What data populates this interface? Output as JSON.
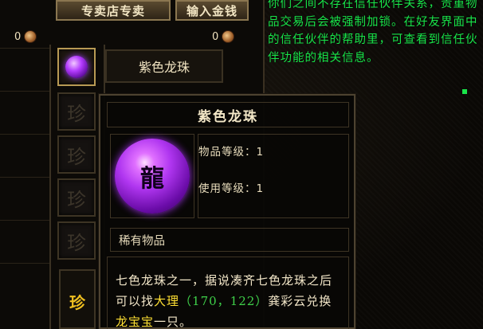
{
  "toolbar": {
    "left_button": "专卖店专卖",
    "right_button": "输入金钱"
  },
  "money": {
    "left_value": "0",
    "right_value": "0"
  },
  "trade": {
    "selected_item_name": "紫色龙珠",
    "slot_glyph": "珍",
    "rare_label": "珍"
  },
  "chat": {
    "text": "你们之间不存在信任伙伴关系，贵重物品交易后会被强制加锁。在好友界面中的信任伙伴的帮助里，可查看到信任伙伴功能的相关信息。"
  },
  "tooltip": {
    "title": "紫色龙珠",
    "orb_glyph": "龍",
    "item_level_label": "物品等级：",
    "item_level": "1",
    "use_level_label": "使用等级：",
    "use_level": "1",
    "rarity": "稀有物品",
    "desc_prefix": "七色龙珠之一，据说凑齐七色龙珠之后可以找",
    "desc_place": "大理",
    "desc_coords": "（170，122）",
    "desc_mid": "龚彩云兑换",
    "desc_reward": "龙宝宝",
    "desc_suffix": "一只。"
  },
  "colors": {
    "chat_green": "#19e54a",
    "highlight_yellow": "#ffe033",
    "coords_green": "#3fd14a",
    "orb_purple": "#b036f0",
    "border_gold": "#8a7650"
  },
  "icons": {
    "coin": "copper-coin-icon",
    "orb": "purple-dragon-orb-icon"
  }
}
